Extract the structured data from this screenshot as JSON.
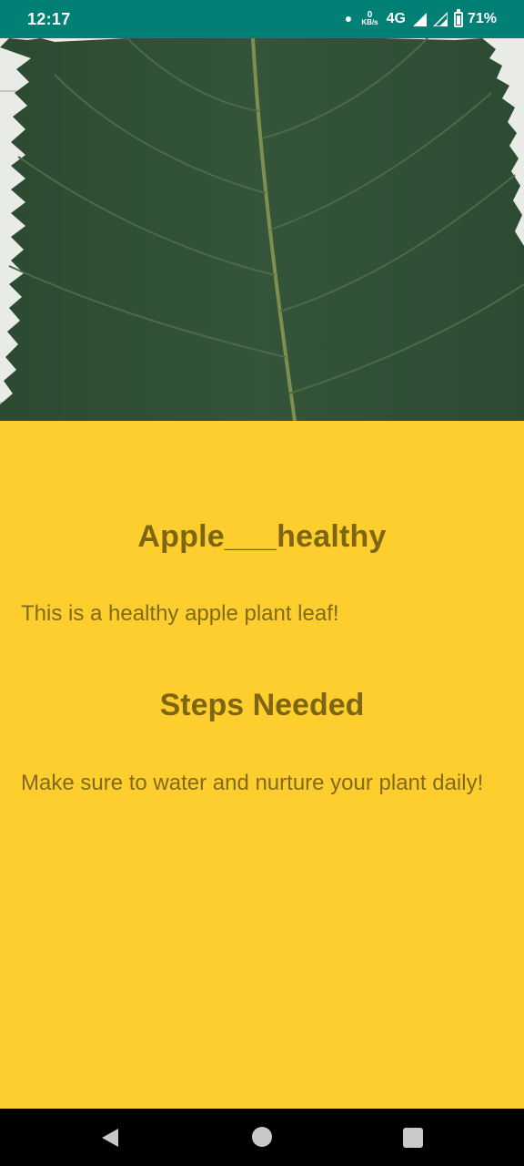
{
  "status_bar": {
    "time": "12:17",
    "data_speed_value": "0",
    "data_speed_unit": "KB/s",
    "network": "4G",
    "battery": "71%"
  },
  "hero_image": {
    "subject": "apple leaf photo",
    "colors": {
      "leaf": "#2f4f34",
      "background": "#e9ebe6"
    }
  },
  "result": {
    "title": "Apple___healthy",
    "description": "This is a healthy apple plant leaf!",
    "steps_heading": "Steps Needed",
    "steps_text": "Make sure to water and nurture your plant daily!"
  },
  "colors": {
    "status_bar": "#028075",
    "content_background": "#fece2f",
    "heading_text": "#7d6512",
    "body_text": "#806a1c"
  },
  "nav_bar": {
    "icons": [
      "back-icon",
      "home-icon",
      "recents-icon"
    ]
  }
}
